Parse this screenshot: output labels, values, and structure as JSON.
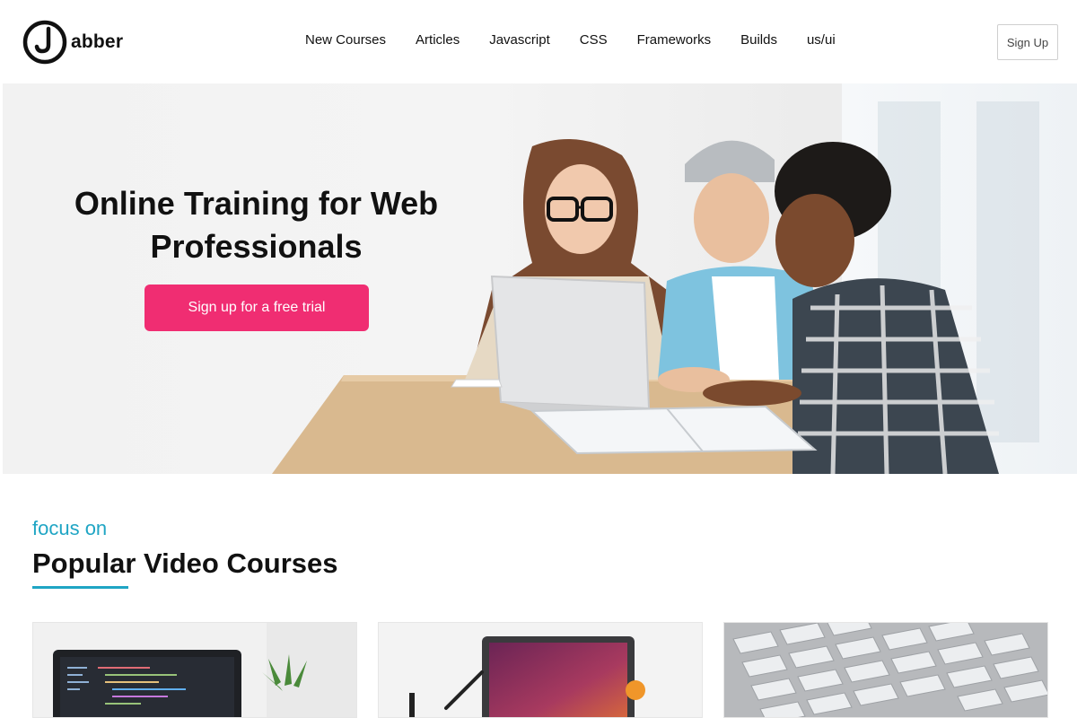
{
  "brand": {
    "name": "abber",
    "logo_icon": "j-circle-logo-icon"
  },
  "nav": {
    "items": [
      "New Courses",
      "Articles",
      "Javascript",
      "CSS",
      "Frameworks",
      "Builds",
      "us/ui"
    ]
  },
  "header": {
    "signup_label": "Sign Up"
  },
  "hero": {
    "title": "Online Training for Web Professionals",
    "cta_label": "Sign up for a free trial",
    "accent_color": "#f02d72"
  },
  "section": {
    "kicker": "focus on",
    "title": "Popular Video Courses",
    "accent_color": "#1fa5c4"
  },
  "courses": [
    {
      "image": "laptop-code-editor-image"
    },
    {
      "image": "laptop-desk-image"
    },
    {
      "image": "keyboard-closeup-image"
    }
  ]
}
